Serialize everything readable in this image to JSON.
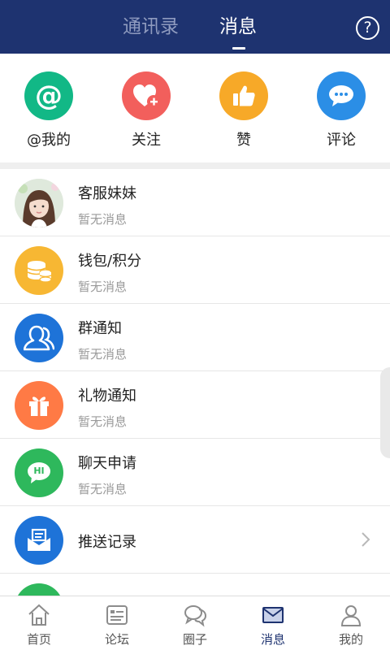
{
  "header": {
    "tabs": [
      {
        "label": "通讯录",
        "active": false
      },
      {
        "label": "消息",
        "active": true
      }
    ],
    "help_glyph": "?",
    "background": "#1e3370"
  },
  "quick_actions": [
    {
      "label": "@我的",
      "icon": "at-icon",
      "color": "#12b886",
      "glyph": "@"
    },
    {
      "label": "关注",
      "icon": "heart-plus-icon",
      "color": "#f25f5c"
    },
    {
      "label": "赞",
      "icon": "thumbs-up-icon",
      "color": "#f7a928"
    },
    {
      "label": "评论",
      "icon": "comment-icon",
      "color": "#2b8ee6"
    }
  ],
  "messages": [
    {
      "title": "客服妹妹",
      "subtitle": "暂无消息",
      "icon": "avatar-photo"
    },
    {
      "title": "钱包/积分",
      "subtitle": "暂无消息",
      "icon": "coins-icon",
      "color": "#f7b733"
    },
    {
      "title": "群通知",
      "subtitle": "暂无消息",
      "icon": "group-icon",
      "color": "#1e73d8"
    },
    {
      "title": "礼物通知",
      "subtitle": "暂无消息",
      "icon": "gift-icon",
      "color": "#ff7a45"
    },
    {
      "title": "聊天申请",
      "subtitle": "暂无消息",
      "icon": "hi-chat-icon",
      "color": "#2eb85c",
      "glyph": "HI"
    },
    {
      "title": "推送记录",
      "icon": "inbox-icon",
      "color": "#1e73d8",
      "has_chevron": true
    }
  ],
  "bottom_nav": [
    {
      "label": "首页",
      "icon": "home-icon",
      "active": false
    },
    {
      "label": "论坛",
      "icon": "forum-icon",
      "active": false
    },
    {
      "label": "圈子",
      "icon": "chat-bubbles-icon",
      "active": false
    },
    {
      "label": "消息",
      "icon": "mail-icon",
      "active": true
    },
    {
      "label": "我的",
      "icon": "user-icon",
      "active": false
    }
  ]
}
